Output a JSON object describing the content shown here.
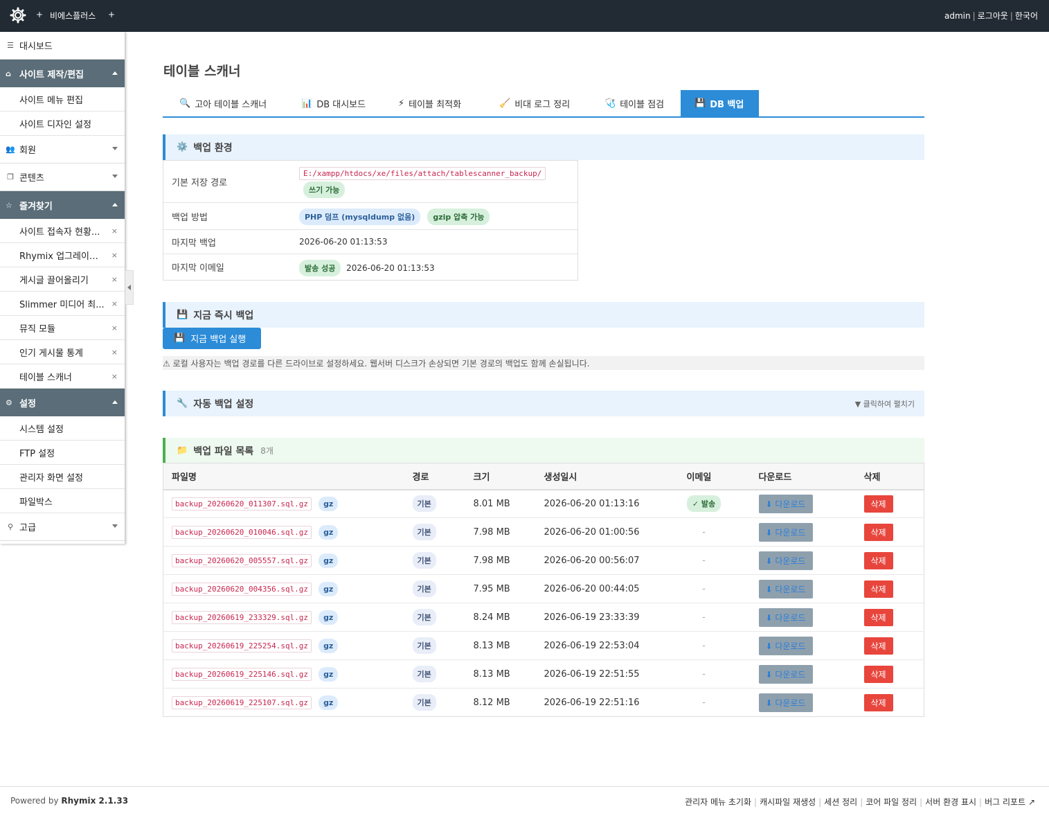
{
  "header": {
    "plus": "+",
    "site_name": "비에스플러스",
    "user": "admin",
    "logout": "로그아웃",
    "language": "한국어",
    "separator": "|"
  },
  "sidebar": {
    "dashboard": "대시보드",
    "site_group": {
      "title": "사이트 제작/편집",
      "items": [
        "사이트 메뉴 편집",
        "사이트 디자인 설정"
      ]
    },
    "members": "회원",
    "contents": "콘텐츠",
    "favorites": {
      "title": "즐겨찾기",
      "items": [
        "사이트 접속자 현황...",
        "Rhymix 업그레이드...",
        "게시글 끌어올리기",
        "Slimmer 미디어 최...",
        "뮤직 모듈",
        "인기 게시물 통계",
        "테이블 스캐너"
      ],
      "remove_glyph": "×"
    },
    "settings": {
      "title": "설정",
      "items": [
        "시스템 설정",
        "FTP 설정",
        "관리자 화면 설정",
        "파일박스"
      ]
    },
    "advanced": "고급"
  },
  "page": {
    "title": "테이블 스캐너"
  },
  "tabs": [
    {
      "label": "고아 테이블 스캐너",
      "icon": "🔍"
    },
    {
      "label": "DB 대시보드",
      "icon": "📊"
    },
    {
      "label": "테이블 최적화",
      "icon": "⚡"
    },
    {
      "label": "비대 로그 정리",
      "icon": "🧹"
    },
    {
      "label": "테이블 점검",
      "icon": "🩺"
    },
    {
      "label": "DB 백업",
      "icon": "💾"
    }
  ],
  "backup_env": {
    "title": "백업 환경",
    "rows": {
      "path_label": "기본 저장 경로",
      "path_value": "E:/xampp/htdocs/xe/files/attach/tablescanner_backup/",
      "path_status": "쓰기 가능",
      "method_label": "백업 방법",
      "method_php": "PHP 덤프 (mysqldump 없음)",
      "method_gzip": "gzip 압축 가능",
      "last_backup_label": "마지막 백업",
      "last_backup_value": "2026-06-20 01:13:53",
      "last_email_label": "마지막 이메일",
      "last_email_status": "발송 성공",
      "last_email_value": "2026-06-20 01:13:53"
    }
  },
  "instant_backup": {
    "title": "지금 즉시 백업",
    "button": "지금 백업 실행",
    "note": "⚠ 로컬 사용자는 백업 경로를 다른 드라이브로 설정하세요. 웹서버 디스크가 손상되면 기본 경로의 백업도 함께 손실됩니다."
  },
  "auto_backup": {
    "title": "자동 백업 설정",
    "expand_hint": "▼ 클릭하여 펼치기"
  },
  "file_list": {
    "title": "백업 파일 목록",
    "count": "8개",
    "columns": [
      "파일명",
      "경로",
      "크기",
      "생성일시",
      "이메일",
      "다운로드",
      "삭제"
    ],
    "download_label": "⬇ 다운로드",
    "delete_label": "삭제",
    "rows": [
      {
        "name": "backup_20260620_011307.sql.gz",
        "type": "gz",
        "path": "기본",
        "size": "8.01 MB",
        "created": "2026-06-20 01:13:16",
        "email": "✓ 발송"
      },
      {
        "name": "backup_20260620_010046.sql.gz",
        "type": "gz",
        "path": "기본",
        "size": "7.98 MB",
        "created": "2026-06-20 01:00:56",
        "email": "-"
      },
      {
        "name": "backup_20260620_005557.sql.gz",
        "type": "gz",
        "path": "기본",
        "size": "7.98 MB",
        "created": "2026-06-20 00:56:07",
        "email": "-"
      },
      {
        "name": "backup_20260620_004356.sql.gz",
        "type": "gz",
        "path": "기본",
        "size": "7.95 MB",
        "created": "2026-06-20 00:44:05",
        "email": "-"
      },
      {
        "name": "backup_20260619_233329.sql.gz",
        "type": "gz",
        "path": "기본",
        "size": "8.24 MB",
        "created": "2026-06-19 23:33:39",
        "email": "-"
      },
      {
        "name": "backup_20260619_225254.sql.gz",
        "type": "gz",
        "path": "기본",
        "size": "8.13 MB",
        "created": "2026-06-19 22:53:04",
        "email": "-"
      },
      {
        "name": "backup_20260619_225146.sql.gz",
        "type": "gz",
        "path": "기본",
        "size": "8.13 MB",
        "created": "2026-06-19 22:51:55",
        "email": "-"
      },
      {
        "name": "backup_20260619_225107.sql.gz",
        "type": "gz",
        "path": "기본",
        "size": "8.12 MB",
        "created": "2026-06-19 22:51:16",
        "email": "-"
      }
    ]
  },
  "footer": {
    "powered": "Powered by",
    "brand": "Rhymix 2.1.33",
    "links": [
      "관리자 메뉴 초기화",
      "캐시파일 재생성",
      "세션 정리",
      "코어 파일 정리",
      "서버 환경 표시",
      "버그 리포트"
    ]
  },
  "colors": {
    "header_bg": "#222b33",
    "accent": "#2c8cd8",
    "sidebar_group": "#5a6d78",
    "danger": "#e8453c"
  }
}
